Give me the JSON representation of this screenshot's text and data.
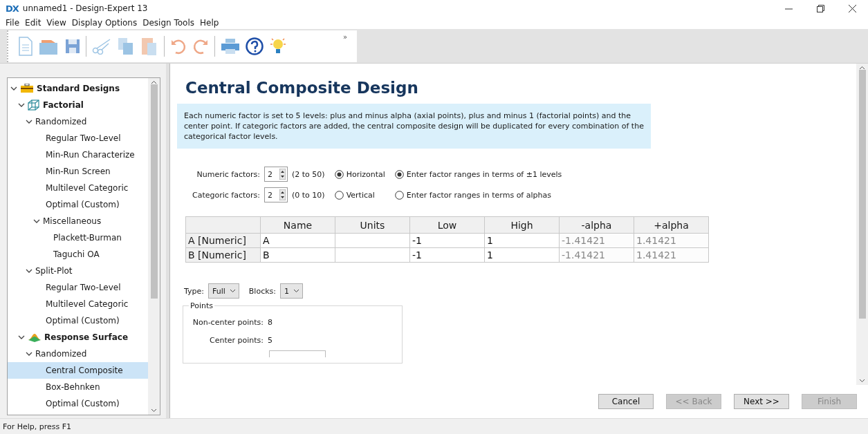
{
  "window": {
    "title": "unnamed1 - Design-Expert 13",
    "app_badge": "DX"
  },
  "menu": [
    "File",
    "Edit",
    "View",
    "Display Options",
    "Design Tools",
    "Help"
  ],
  "toolbar": {
    "overflow": "»"
  },
  "tree": [
    {
      "label": "Standard Designs",
      "kind": "toolbox",
      "expanded": true,
      "selected": false,
      "children": [
        {
          "label": "Factorial",
          "kind": "cube",
          "expanded": true,
          "selected": false,
          "children": [
            {
              "label": "Randomized",
              "kind": "group",
              "expanded": true,
              "selected": false,
              "children": [
                {
                  "label": "Regular Two-Level",
                  "kind": "design",
                  "selected": false
                },
                {
                  "label": "Min-Run Characterize",
                  "kind": "design",
                  "selected": false
                },
                {
                  "label": "Min-Run Screen",
                  "kind": "design",
                  "selected": false
                },
                {
                  "label": "Multilevel Categoric",
                  "kind": "design",
                  "selected": false
                },
                {
                  "label": "Optimal (Custom)",
                  "kind": "design",
                  "selected": false
                },
                {
                  "label": "Miscellaneous",
                  "kind": "group",
                  "expanded": true,
                  "selected": false,
                  "children": [
                    {
                      "label": "Plackett-Burman",
                      "kind": "design",
                      "selected": false
                    },
                    {
                      "label": "Taguchi OA",
                      "kind": "design",
                      "selected": false
                    }
                  ]
                }
              ]
            },
            {
              "label": "Split-Plot",
              "kind": "group",
              "expanded": true,
              "selected": false,
              "children": [
                {
                  "label": "Regular Two-Level",
                  "kind": "design",
                  "selected": false
                },
                {
                  "label": "Multilevel Categoric",
                  "kind": "design",
                  "selected": false
                },
                {
                  "label": "Optimal (Custom)",
                  "kind": "design",
                  "selected": false
                }
              ]
            }
          ]
        },
        {
          "label": "Response Surface",
          "kind": "surface",
          "expanded": true,
          "selected": false,
          "children": [
            {
              "label": "Randomized",
              "kind": "group",
              "expanded": true,
              "selected": false,
              "children": [
                {
                  "label": "Central Composite",
                  "kind": "design",
                  "selected": true
                },
                {
                  "label": "Box-Behnken",
                  "kind": "design",
                  "selected": false
                },
                {
                  "label": "Optimal (Custom)",
                  "kind": "design",
                  "selected": false
                }
              ]
            }
          ]
        }
      ]
    }
  ],
  "heading": "Central Composite Design",
  "description": "Each numeric factor is set to 5 levels: plus and minus alpha (axial points), plus and minus 1 (factorial points) and the center point. If categoric factors are added, the central composite design will be duplicated for every combination of the categorical factor levels.",
  "factor_counts": [
    {
      "label": "Numeric factors:",
      "value": "2",
      "range": "(2 to 50)"
    },
    {
      "label": "Categoric factors:",
      "value": "2",
      "range": "(0 to 10)"
    }
  ],
  "layout_options": [
    {
      "label": "Horizontal",
      "selected": true
    },
    {
      "label": "Vertical",
      "selected": false
    }
  ],
  "range_options": [
    {
      "label": "Enter factor ranges in terms of ±1 levels",
      "selected": true
    },
    {
      "label": "Enter factor ranges in terms of alphas",
      "selected": false
    }
  ],
  "table": {
    "columns": [
      {
        "label": "Name"
      },
      {
        "label": "Units"
      },
      {
        "label": "Low"
      },
      {
        "label": "High"
      },
      {
        "label": "-alpha",
        "disabled": true
      },
      {
        "label": "+alpha",
        "disabled": true
      }
    ],
    "rows": [
      {
        "header": "A [Numeric]",
        "cells": [
          "A",
          "",
          "-1",
          "1",
          "-1.41421",
          "1.41421"
        ]
      },
      {
        "header": "B [Numeric]",
        "cells": [
          "B",
          "",
          "-1",
          "1",
          "-1.41421",
          "1.41421"
        ]
      }
    ]
  },
  "type": {
    "label": "Type:",
    "value": "Full"
  },
  "blocks": {
    "label": "Blocks:",
    "value": "1"
  },
  "points": {
    "title": "Points",
    "rows": [
      {
        "label": "Non-center points:",
        "value": "8"
      },
      {
        "label": "Center points:",
        "value": "5"
      }
    ]
  },
  "buttons": [
    {
      "label": "Cancel",
      "disabled": false
    },
    {
      "label": "<< Back",
      "disabled": true
    },
    {
      "label": "Next >>",
      "disabled": false
    },
    {
      "label": "Finish",
      "disabled": true
    }
  ],
  "status_bar": "For Help, press F1"
}
